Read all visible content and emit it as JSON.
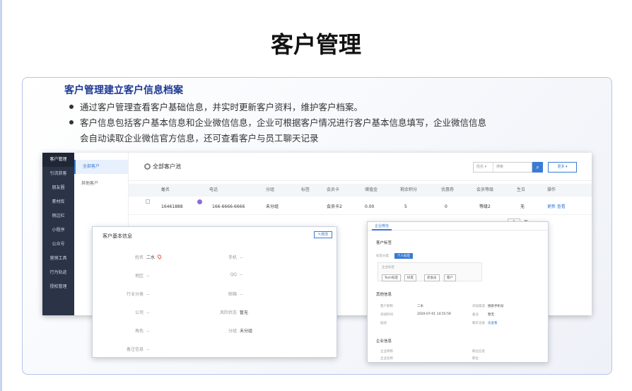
{
  "slide": {
    "title": "客户管理",
    "heading": "客户管理建立客户信息档案",
    "bullets": [
      "通过客户管理查看客户基础信息，并实时更新客户资料，维护客户档案。",
      "客户信息包括客户基本信息和企业微信信息，企业可根据客户情况进行客户基本信息填写，企业微信信息",
      "会自动读取企业微信官方信息，还可查看客户与员工聊天记录"
    ]
  },
  "app": {
    "sidebar": [
      "客户管理",
      "引流获客",
      "朋友圈",
      "素材库",
      "侧边栏",
      "小程序",
      "公众号",
      "营销工具",
      "行为轨迹",
      "授权管理"
    ],
    "subnav": [
      "全部客户",
      "其他客户"
    ],
    "scope_label": "全部客户池",
    "search": {
      "select": "姓名",
      "placeholder": "搜索",
      "more": "更多"
    },
    "table": {
      "headers": [
        "姓名",
        "电话",
        "分组",
        "标签",
        "会员卡",
        "储值金",
        "剩余积分",
        "优惠券",
        "会员等级",
        "生日",
        "操作"
      ],
      "row": {
        "name": "16461888",
        "phone": "166-6666-6666",
        "group": "未分组",
        "tag": "",
        "card": "会员卡2",
        "balance": "0.00",
        "points": "5",
        "coupons": "0",
        "level": "等级2",
        "birthday": "无",
        "actions": "更新 查看"
      }
    },
    "pager": {
      "page": "1",
      "unit": "页"
    }
  },
  "basic_panel": {
    "title": "客户基本信息",
    "edit": "修改",
    "fields": [
      {
        "label": "姓名",
        "value": "二水"
      },
      {
        "label": "手机",
        "value": "--"
      },
      {
        "label": "地区",
        "value": "--"
      },
      {
        "label": "QQ",
        "value": "--"
      },
      {
        "label": "行业分类",
        "value": "--"
      },
      {
        "label": "邮箱",
        "value": "--"
      },
      {
        "label": "公司",
        "value": "--"
      },
      {
        "label": "风险状态",
        "value": "暂无"
      },
      {
        "label": "角色",
        "value": "--"
      },
      {
        "label": "分组",
        "value": "未分组"
      },
      {
        "label": "备注信息",
        "value": "--"
      }
    ]
  },
  "wx_panel": {
    "tab": "企业微信",
    "customer_tags": "客户标签",
    "tag_group": "标签分类",
    "active_tag": "个人标签",
    "company_tags": "企业标签",
    "tags": [
      "Tech标签",
      "好友",
      "老会员",
      "客户"
    ],
    "other_info": "其他信息",
    "rows": [
      {
        "l": "客户昵称",
        "v": "二水",
        "l2": "添加渠道",
        "v2": "搜索手机号"
      },
      {
        "l": "添加时间",
        "v": "2020-07-01 14:55:59",
        "l2": "备注",
        "v2": "暂无"
      },
      {
        "l": "描述",
        "v": "",
        "l2": "聊天记录",
        "v2": "去查看"
      }
    ],
    "enterprise_info": "企业信息",
    "ent_rows": [
      {
        "l": "企业简称",
        "l2": "职位信息"
      },
      {
        "l": "企业名称",
        "l2": "职位"
      }
    ]
  }
}
